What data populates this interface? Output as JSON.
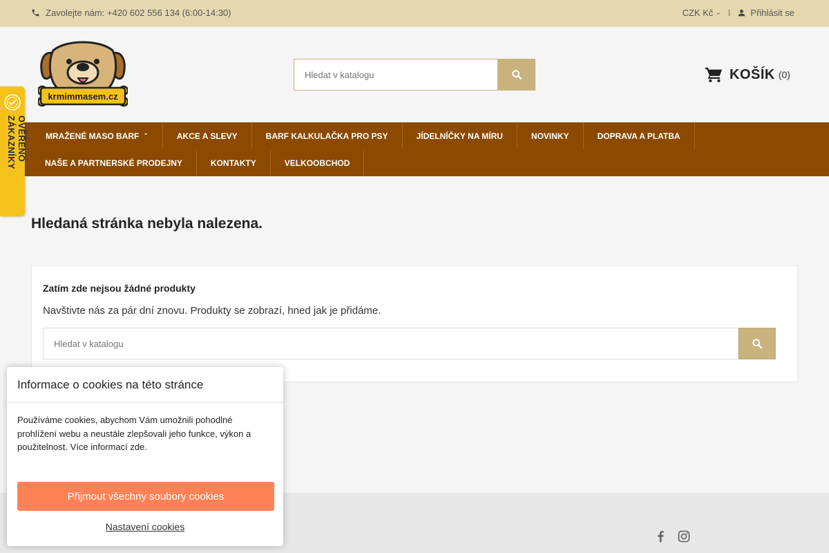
{
  "topbar": {
    "phone_text": "Zavolejte nám: +420 602 556 134 (6:00-14:30)",
    "currency": "CZK Kč",
    "separator": "I",
    "login": "Přihlásit se"
  },
  "header": {
    "logo_text": "krmimmasem.cz",
    "search_placeholder": "Hledat v katalogu",
    "cart_label": "KOŠÍK",
    "cart_count": "(0)"
  },
  "nav": {
    "row1": [
      "MRAŽENÉ MASO BARF",
      "AKCE A SLEVY",
      "BARF KALKULAČKA PRO PSY",
      "JÍDELNÍČKY NA MÍRU",
      "NOVINKY",
      "DOPRAVA A PLATBA"
    ],
    "row2": [
      "NAŠE A PARTNERSKÉ PRODEJNY",
      "KONTAKTY",
      "VELKOOBCHOD"
    ]
  },
  "badge": {
    "text": "OVĚŘENO ZÁKAZNÍKY"
  },
  "main": {
    "page_title": "Hledaná stránka nebyla nalezena.",
    "empty_title": "Zatím zde nejsou žádné produkty",
    "empty_text": "Navštivte nás za pár dní znovu. Produkty se zobrazí, hned jak je přidáme.",
    "search_placeholder": "Hledat v katalogu"
  },
  "cookie": {
    "title": "Informace o cookies na této stránce",
    "text": "Používáme cookies, abychom Vám umožnili pohodlné prohlížení webu a neustále zlepšovali jeho funkce, výkon a použitelnost. Více informací zde.",
    "accept": "Přijmout všechny soubory cookies",
    "settings": "Nastavení cookies"
  },
  "colors": {
    "topbar_bg": "#e5d8b0",
    "nav_bg": "#8b4a00",
    "accent": "#c8b27d",
    "cookie_button": "#ff8155",
    "badge": "#f4c21b"
  },
  "icons": [
    "phone-icon",
    "user-icon",
    "search-icon",
    "cart-icon",
    "facebook-icon",
    "instagram-icon",
    "dog-logo"
  ]
}
